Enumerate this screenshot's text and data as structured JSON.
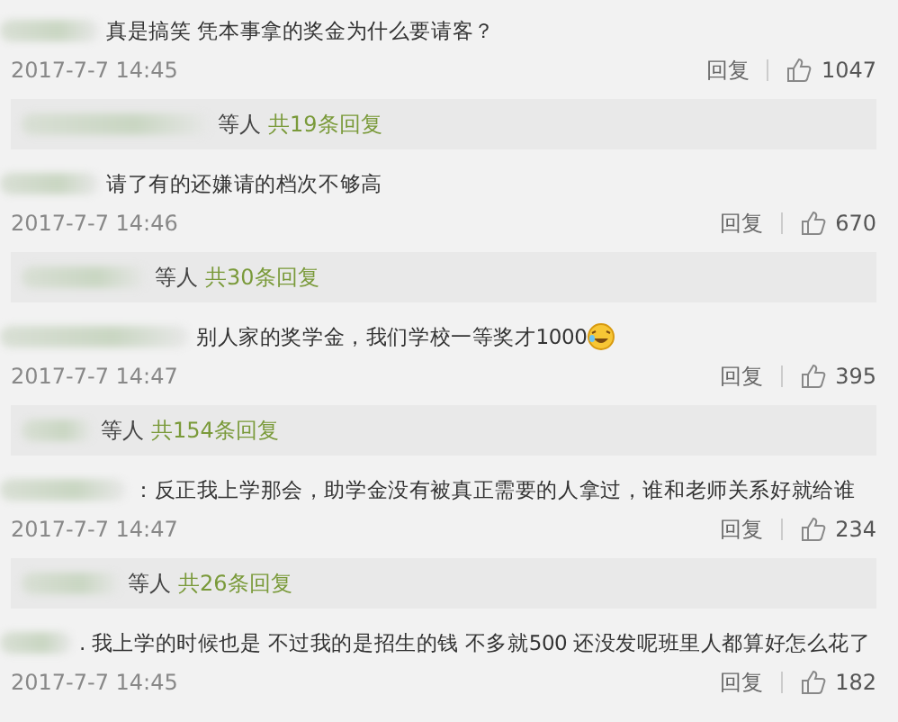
{
  "comments": [
    {
      "text": "真是搞笑 凭本事拿的奖金为什么要请客？",
      "emoji": false,
      "time": "2017-7-7 14:45",
      "reply_label": "回复",
      "likes": "1047",
      "replies": {
        "suffix": "等人",
        "count": "共19条回复"
      }
    },
    {
      "text": "请了有的还嫌请的档次不够高",
      "emoji": false,
      "time": "2017-7-7 14:46",
      "reply_label": "回复",
      "likes": "670",
      "replies": {
        "suffix": "等人",
        "count": "共30条回复"
      }
    },
    {
      "text": "别人家的奖学金，我们学校一等奖才1000",
      "emoji": true,
      "time": "2017-7-7 14:47",
      "reply_label": "回复",
      "likes": "395",
      "replies": {
        "suffix": "等人",
        "count": "共154条回复"
      }
    },
    {
      "text": "：反正我上学那会，助学金没有被真正需要的人拿过，谁和老师关系好就给谁",
      "emoji": false,
      "time": "2017-7-7 14:47",
      "reply_label": "回复",
      "likes": "234",
      "replies": {
        "suffix": "等人",
        "count": "共26条回复"
      }
    },
    {
      "text": ". 我上学的时候也是 不过我的是招生的钱 不多就500 还没发呢班里人都算好怎么花了",
      "emoji": false,
      "time": "2017-7-7 14:45",
      "reply_label": "回复",
      "likes": "182"
    }
  ]
}
